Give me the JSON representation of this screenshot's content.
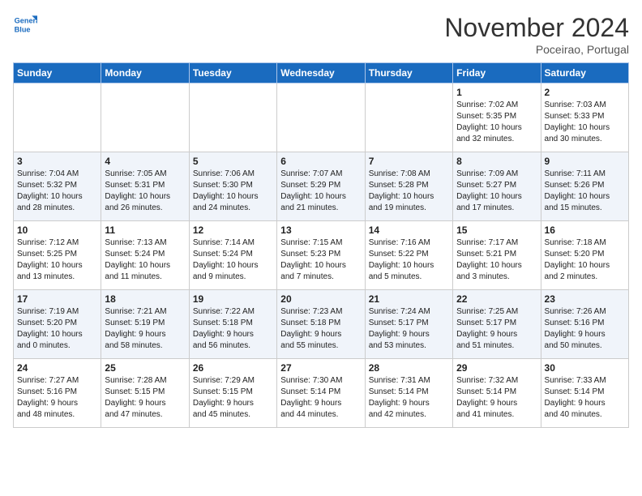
{
  "header": {
    "logo_line1": "General",
    "logo_line2": "Blue",
    "month": "November 2024",
    "location": "Poceirao, Portugal"
  },
  "days_of_week": [
    "Sunday",
    "Monday",
    "Tuesday",
    "Wednesday",
    "Thursday",
    "Friday",
    "Saturday"
  ],
  "weeks": [
    [
      {
        "day": "",
        "info": ""
      },
      {
        "day": "",
        "info": ""
      },
      {
        "day": "",
        "info": ""
      },
      {
        "day": "",
        "info": ""
      },
      {
        "day": "",
        "info": ""
      },
      {
        "day": "1",
        "info": "Sunrise: 7:02 AM\nSunset: 5:35 PM\nDaylight: 10 hours\nand 32 minutes."
      },
      {
        "day": "2",
        "info": "Sunrise: 7:03 AM\nSunset: 5:33 PM\nDaylight: 10 hours\nand 30 minutes."
      }
    ],
    [
      {
        "day": "3",
        "info": "Sunrise: 7:04 AM\nSunset: 5:32 PM\nDaylight: 10 hours\nand 28 minutes."
      },
      {
        "day": "4",
        "info": "Sunrise: 7:05 AM\nSunset: 5:31 PM\nDaylight: 10 hours\nand 26 minutes."
      },
      {
        "day": "5",
        "info": "Sunrise: 7:06 AM\nSunset: 5:30 PM\nDaylight: 10 hours\nand 24 minutes."
      },
      {
        "day": "6",
        "info": "Sunrise: 7:07 AM\nSunset: 5:29 PM\nDaylight: 10 hours\nand 21 minutes."
      },
      {
        "day": "7",
        "info": "Sunrise: 7:08 AM\nSunset: 5:28 PM\nDaylight: 10 hours\nand 19 minutes."
      },
      {
        "day": "8",
        "info": "Sunrise: 7:09 AM\nSunset: 5:27 PM\nDaylight: 10 hours\nand 17 minutes."
      },
      {
        "day": "9",
        "info": "Sunrise: 7:11 AM\nSunset: 5:26 PM\nDaylight: 10 hours\nand 15 minutes."
      }
    ],
    [
      {
        "day": "10",
        "info": "Sunrise: 7:12 AM\nSunset: 5:25 PM\nDaylight: 10 hours\nand 13 minutes."
      },
      {
        "day": "11",
        "info": "Sunrise: 7:13 AM\nSunset: 5:24 PM\nDaylight: 10 hours\nand 11 minutes."
      },
      {
        "day": "12",
        "info": "Sunrise: 7:14 AM\nSunset: 5:24 PM\nDaylight: 10 hours\nand 9 minutes."
      },
      {
        "day": "13",
        "info": "Sunrise: 7:15 AM\nSunset: 5:23 PM\nDaylight: 10 hours\nand 7 minutes."
      },
      {
        "day": "14",
        "info": "Sunrise: 7:16 AM\nSunset: 5:22 PM\nDaylight: 10 hours\nand 5 minutes."
      },
      {
        "day": "15",
        "info": "Sunrise: 7:17 AM\nSunset: 5:21 PM\nDaylight: 10 hours\nand 3 minutes."
      },
      {
        "day": "16",
        "info": "Sunrise: 7:18 AM\nSunset: 5:20 PM\nDaylight: 10 hours\nand 2 minutes."
      }
    ],
    [
      {
        "day": "17",
        "info": "Sunrise: 7:19 AM\nSunset: 5:20 PM\nDaylight: 10 hours\nand 0 minutes."
      },
      {
        "day": "18",
        "info": "Sunrise: 7:21 AM\nSunset: 5:19 PM\nDaylight: 9 hours\nand 58 minutes."
      },
      {
        "day": "19",
        "info": "Sunrise: 7:22 AM\nSunset: 5:18 PM\nDaylight: 9 hours\nand 56 minutes."
      },
      {
        "day": "20",
        "info": "Sunrise: 7:23 AM\nSunset: 5:18 PM\nDaylight: 9 hours\nand 55 minutes."
      },
      {
        "day": "21",
        "info": "Sunrise: 7:24 AM\nSunset: 5:17 PM\nDaylight: 9 hours\nand 53 minutes."
      },
      {
        "day": "22",
        "info": "Sunrise: 7:25 AM\nSunset: 5:17 PM\nDaylight: 9 hours\nand 51 minutes."
      },
      {
        "day": "23",
        "info": "Sunrise: 7:26 AM\nSunset: 5:16 PM\nDaylight: 9 hours\nand 50 minutes."
      }
    ],
    [
      {
        "day": "24",
        "info": "Sunrise: 7:27 AM\nSunset: 5:16 PM\nDaylight: 9 hours\nand 48 minutes."
      },
      {
        "day": "25",
        "info": "Sunrise: 7:28 AM\nSunset: 5:15 PM\nDaylight: 9 hours\nand 47 minutes."
      },
      {
        "day": "26",
        "info": "Sunrise: 7:29 AM\nSunset: 5:15 PM\nDaylight: 9 hours\nand 45 minutes."
      },
      {
        "day": "27",
        "info": "Sunrise: 7:30 AM\nSunset: 5:14 PM\nDaylight: 9 hours\nand 44 minutes."
      },
      {
        "day": "28",
        "info": "Sunrise: 7:31 AM\nSunset: 5:14 PM\nDaylight: 9 hours\nand 42 minutes."
      },
      {
        "day": "29",
        "info": "Sunrise: 7:32 AM\nSunset: 5:14 PM\nDaylight: 9 hours\nand 41 minutes."
      },
      {
        "day": "30",
        "info": "Sunrise: 7:33 AM\nSunset: 5:14 PM\nDaylight: 9 hours\nand 40 minutes."
      }
    ]
  ]
}
